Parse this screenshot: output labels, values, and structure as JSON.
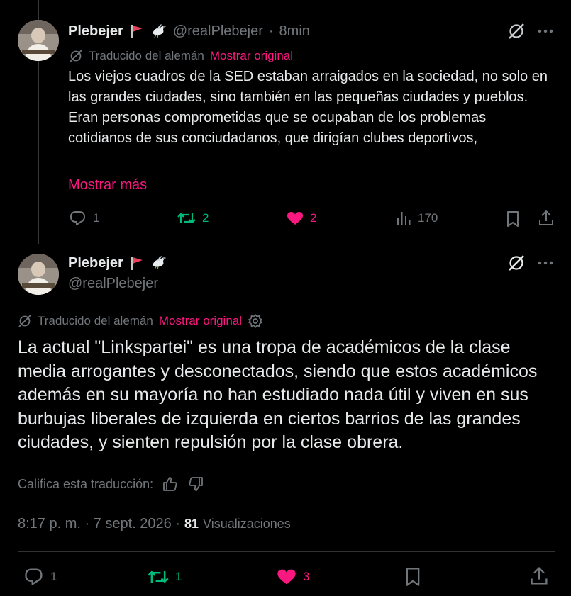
{
  "tweet1": {
    "name": "Plebejer",
    "handle": "@realPlebejer",
    "sep": "·",
    "time": "8min",
    "translated_label": "Traducido del alemán",
    "show_original": "Mostrar original",
    "text": "Los viejos cuadros de la SED estaban arraigados en la sociedad, no solo en las grandes ciudades, sino también en las pequeñas ciudades y pueblos. Eran personas comprometidas que se ocupaban de los problemas cotidianos de sus conciudadanos, que dirigían clubes deportivos,",
    "show_more": "Mostrar más",
    "replies": "1",
    "reposts": "2",
    "likes": "2",
    "views": "170"
  },
  "tweet2": {
    "name": "Plebejer",
    "handle": "@realPlebejer",
    "translated_label": "Traducido del alemán",
    "show_original": "Mostrar original",
    "text": "La actual \"Linkspartei\" es una tropa de académicos de la clase media arrogantes y desconectados, siendo que estos académicos además en su mayoría no han estudiado nada útil y viven en sus burbujas liberales de izquierda en ciertos barrios de las grandes ciudades, y sienten repulsión por la clase obrera.",
    "rate_label": "Califica esta traducción:",
    "timestamp": "8:17 p. m. · 7 sept. 2026 ·",
    "views_count": "81",
    "views_label": "Visualizaciones",
    "replies": "1",
    "reposts": "1",
    "likes": "3"
  },
  "colors": {
    "accent_pink": "#f91880",
    "repost_green": "#00ba7c",
    "muted": "#71767b",
    "text": "#e7e9ea",
    "background": "#000000"
  },
  "icons": [
    "flag-icon",
    "dove-icon",
    "grok-icon",
    "more-icon",
    "translate-icon",
    "settings-gear-icon",
    "reply-icon",
    "repost-icon",
    "heart-icon",
    "views-icon",
    "bookmark-icon",
    "share-icon",
    "thumbs-up-icon",
    "thumbs-down-icon"
  ]
}
